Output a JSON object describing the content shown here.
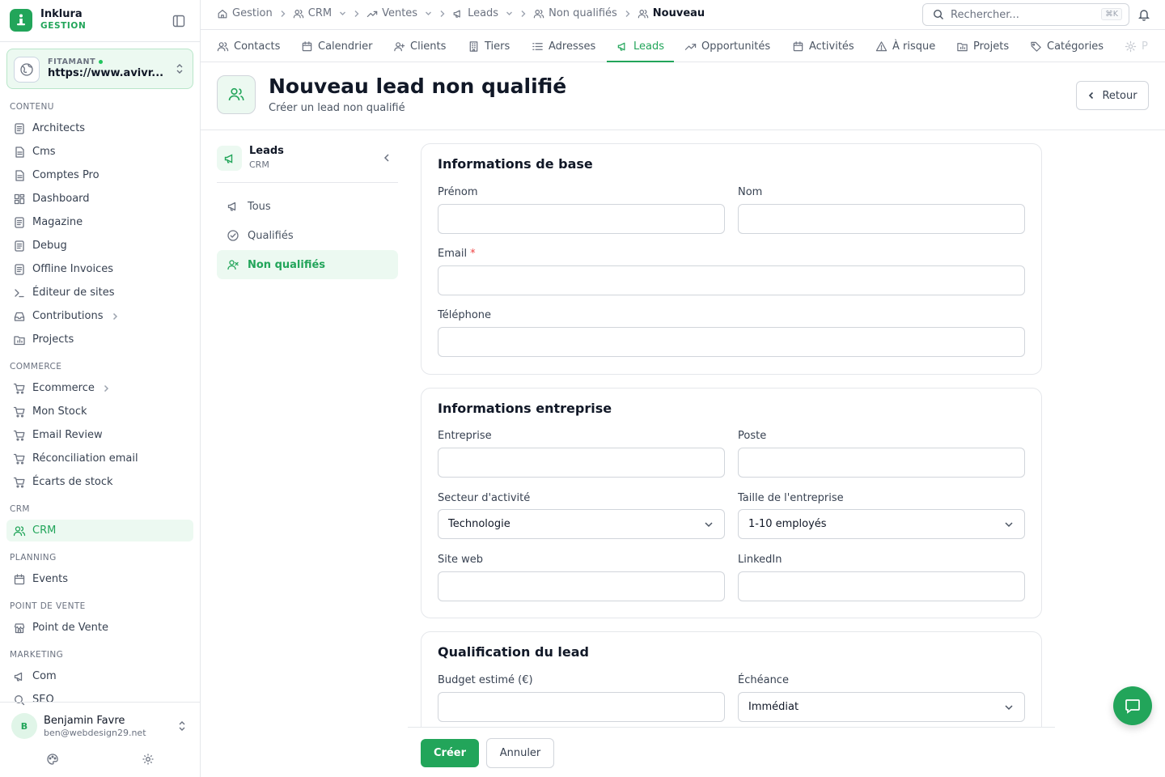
{
  "brand": {
    "name": "Inklura",
    "subtitle": "GESTION"
  },
  "site": {
    "label": "FITAMANT",
    "url": "https://www.avivr..."
  },
  "sidebar": {
    "sections": [
      {
        "title": "CONTENU",
        "items": [
          {
            "label": "Architects",
            "icon": "file-list-icon"
          },
          {
            "label": "Cms",
            "icon": "document-icon"
          },
          {
            "label": "Comptes Pro",
            "icon": "document-icon"
          },
          {
            "label": "Dashboard",
            "icon": "dashboard-grid-icon"
          },
          {
            "label": "Magazine",
            "icon": "file-list-icon"
          },
          {
            "label": "Debug",
            "icon": "file-list-icon"
          },
          {
            "label": "Offline Invoices",
            "icon": "file-list-icon"
          },
          {
            "label": "Éditeur de sites",
            "icon": "terminal-icon"
          },
          {
            "label": "Contributions",
            "icon": "inbox-icon",
            "has_children": true
          },
          {
            "label": "Projects",
            "icon": "folder-chart-icon"
          }
        ]
      },
      {
        "title": "COMMERCE",
        "items": [
          {
            "label": "Ecommerce",
            "icon": "cart-icon",
            "has_children": true
          },
          {
            "label": "Mon Stock",
            "icon": "cart-icon"
          },
          {
            "label": "Email Review",
            "icon": "cart-icon"
          },
          {
            "label": "Réconciliation email",
            "icon": "cart-icon"
          },
          {
            "label": "Écarts de stock",
            "icon": "cart-icon"
          }
        ]
      },
      {
        "title": "CRM",
        "items": [
          {
            "label": "CRM",
            "icon": "users-icon",
            "active": true
          }
        ]
      },
      {
        "title": "PLANNING",
        "items": [
          {
            "label": "Events",
            "icon": "calendar-icon"
          }
        ]
      },
      {
        "title": "POINT DE VENTE",
        "items": [
          {
            "label": "Point de Vente",
            "icon": "store-icon"
          }
        ]
      },
      {
        "title": "MARKETING",
        "items": [
          {
            "label": "Com",
            "icon": "megaphone-icon"
          },
          {
            "label": "SEO",
            "icon": "search-icon"
          }
        ]
      }
    ]
  },
  "user": {
    "initial": "B",
    "name": "Benjamin Favre",
    "email": "ben@webdesign29.net"
  },
  "breadcrumb": [
    {
      "label": "Gestion",
      "icon": "home-icon"
    },
    {
      "label": "CRM",
      "icon": "users-icon",
      "dropdown": true
    },
    {
      "label": "Ventes",
      "icon": "trend-icon",
      "dropdown": true
    },
    {
      "label": "Leads",
      "icon": "megaphone-icon",
      "dropdown": true
    },
    {
      "label": "Non qualifiés",
      "icon": "users-icon"
    },
    {
      "label": "Nouveau",
      "icon": "users-icon",
      "current": true
    }
  ],
  "search": {
    "placeholder": "Rechercher...",
    "shortcut": "⌘K"
  },
  "tabs": [
    {
      "label": "Contacts",
      "icon": "users-icon"
    },
    {
      "label": "Calendrier",
      "icon": "calendar-icon"
    },
    {
      "label": "Clients",
      "icon": "user-plus-icon"
    },
    {
      "label": "Tiers",
      "icon": "building-icon"
    },
    {
      "label": "Adresses",
      "icon": "list-icon"
    },
    {
      "label": "Leads",
      "icon": "megaphone-icon",
      "active": true
    },
    {
      "label": "Opportunités",
      "icon": "trend-icon"
    },
    {
      "label": "Activités",
      "icon": "calendar-icon"
    },
    {
      "label": "À risque",
      "icon": "warning-icon"
    },
    {
      "label": "Projets",
      "icon": "folder-chart-icon"
    },
    {
      "label": "Catégories",
      "icon": "tag-icon"
    },
    {
      "label": "P",
      "icon": "gear-icon"
    }
  ],
  "page": {
    "title": "Nouveau lead non qualifié",
    "subtitle": "Créer un lead non qualifié",
    "back_label": "Retour"
  },
  "subnav": {
    "title": "Leads",
    "subtitle": "CRM",
    "items": [
      {
        "label": "Tous",
        "icon": "megaphone-icon"
      },
      {
        "label": "Qualifiés",
        "icon": "check-circle-icon"
      },
      {
        "label": "Non qualifiés",
        "icon": "user-x-icon",
        "active": true
      }
    ]
  },
  "form": {
    "basic": {
      "title": "Informations de base",
      "first_name": {
        "label": "Prénom",
        "value": ""
      },
      "last_name": {
        "label": "Nom",
        "value": ""
      },
      "email": {
        "label": "Email",
        "required_mark": "*",
        "value": ""
      },
      "phone": {
        "label": "Téléphone",
        "value": ""
      }
    },
    "company": {
      "title": "Informations entreprise",
      "company": {
        "label": "Entreprise",
        "value": ""
      },
      "position": {
        "label": "Poste",
        "value": ""
      },
      "sector": {
        "label": "Secteur d'activité",
        "value": "Technologie"
      },
      "size": {
        "label": "Taille de l'entreprise",
        "value": "1-10 employés"
      },
      "website": {
        "label": "Site web",
        "value": ""
      },
      "linkedin": {
        "label": "LinkedIn",
        "value": ""
      }
    },
    "qualification": {
      "title": "Qualification du lead",
      "budget": {
        "label": "Budget estimé (€)",
        "value": ""
      },
      "deadline": {
        "label": "Échéance",
        "value": "Immédiat"
      }
    },
    "actions": {
      "create_label": "Créer",
      "cancel_label": "Annuler"
    }
  },
  "colors": {
    "accent": "#22a55a",
    "accent_light": "#ecf9f1",
    "border": "#e5e7eb",
    "text": "#111827",
    "muted": "#6b7280"
  }
}
